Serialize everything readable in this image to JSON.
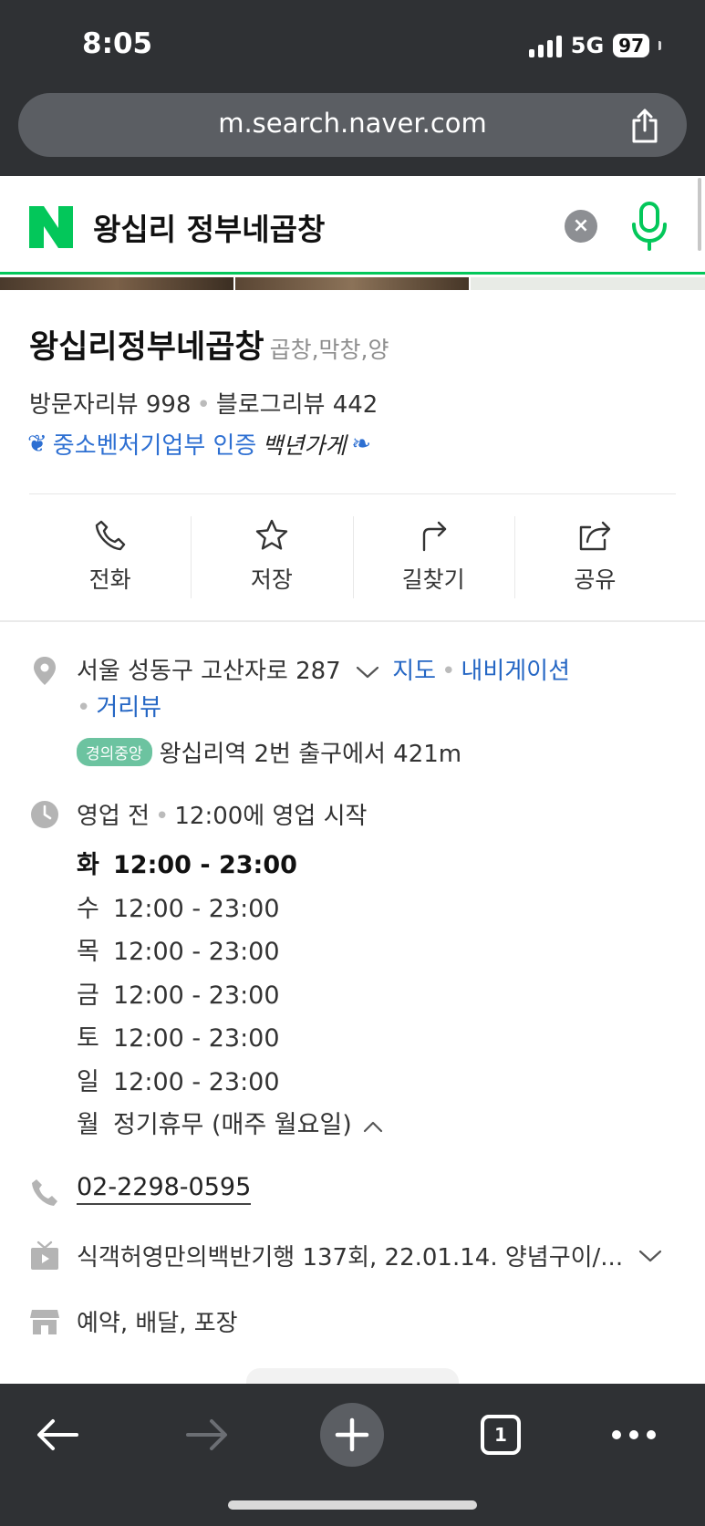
{
  "status_bar": {
    "time": "8:05",
    "network": "5G",
    "battery": "97"
  },
  "browser": {
    "url": "m.search.naver.com"
  },
  "search": {
    "query": "왕십리 정부네곱창",
    "clear_label": "×"
  },
  "place": {
    "name": "왕십리정부네곱창",
    "category": "곱창,막창,양",
    "visitor_reviews": "방문자리뷰 998",
    "blog_reviews": "블로그리뷰 442",
    "certification": "중소벤처기업부 인증",
    "cert_mark": "백년가게"
  },
  "actions": [
    {
      "label": "전화",
      "icon": "phone-icon"
    },
    {
      "label": "저장",
      "icon": "star-icon"
    },
    {
      "label": "길찾기",
      "icon": "directions-icon"
    },
    {
      "label": "공유",
      "icon": "share-icon"
    }
  ],
  "address": {
    "text": "서울 성동구 고산자로 287",
    "map_link": "지도",
    "nav_link": "내비게이션",
    "street_view_link": "거리뷰",
    "subway_line": "경의중앙",
    "subway_text": "왕십리역 2번 출구에서 421m"
  },
  "hours": {
    "status": "영업 전",
    "status_detail": "12:00에 영업 시작",
    "days": [
      {
        "day": "화",
        "time": "12:00 - 23:00",
        "today": true
      },
      {
        "day": "수",
        "time": "12:00 - 23:00"
      },
      {
        "day": "목",
        "time": "12:00 - 23:00"
      },
      {
        "day": "금",
        "time": "12:00 - 23:00"
      },
      {
        "day": "토",
        "time": "12:00 - 23:00"
      },
      {
        "day": "일",
        "time": "12:00 - 23:00"
      },
      {
        "day": "월",
        "time": "정기휴무 (매주 월요일)"
      }
    ]
  },
  "phone": "02-2298-0595",
  "tv": "식객허영만의백반기행 137회, 22.01.14. 양념구이/...",
  "services": "예약, 배달, 포장",
  "toolbar": {
    "tab_count": "1"
  },
  "colors": {
    "naver_green": "#03c75a",
    "link_blue": "#2466c4",
    "chrome_dark": "#2f3134"
  }
}
